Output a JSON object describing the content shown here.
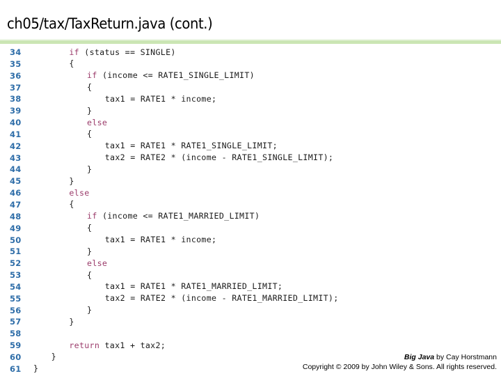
{
  "slide": {
    "title": "ch05/tax/TaxReturn.java (cont.)",
    "accent_color": "#CBE6B4",
    "line_number_color": "#2E6DA8",
    "keyword_color": "#9B3C6B",
    "code_color": "#1a1a1a",
    "background_color": "#ffffff"
  },
  "code": {
    "language": "java",
    "first_line_number": 34,
    "last_line_number": 61,
    "lines": [
      {
        "n": "34",
        "indent": 6,
        "keyword": "if",
        "rest": " (status == SINGLE)"
      },
      {
        "n": "35",
        "indent": 6,
        "keyword": "",
        "rest": "{"
      },
      {
        "n": "36",
        "indent": 9,
        "keyword": "if",
        "rest": " (income <= RATE1_SINGLE_LIMIT)"
      },
      {
        "n": "37",
        "indent": 9,
        "keyword": "",
        "rest": "{"
      },
      {
        "n": "38",
        "indent": 12,
        "keyword": "",
        "rest": "tax1 = RATE1 * income;"
      },
      {
        "n": "39",
        "indent": 9,
        "keyword": "",
        "rest": "}"
      },
      {
        "n": "40",
        "indent": 9,
        "keyword": "else",
        "rest": ""
      },
      {
        "n": "41",
        "indent": 9,
        "keyword": "",
        "rest": "{"
      },
      {
        "n": "42",
        "indent": 12,
        "keyword": "",
        "rest": "tax1 = RATE1 * RATE1_SINGLE_LIMIT;"
      },
      {
        "n": "43",
        "indent": 12,
        "keyword": "",
        "rest": "tax2 = RATE2 * (income - RATE1_SINGLE_LIMIT);"
      },
      {
        "n": "44",
        "indent": 9,
        "keyword": "",
        "rest": "}"
      },
      {
        "n": "45",
        "indent": 6,
        "keyword": "",
        "rest": "}"
      },
      {
        "n": "46",
        "indent": 6,
        "keyword": "else",
        "rest": ""
      },
      {
        "n": "47",
        "indent": 6,
        "keyword": "",
        "rest": "{"
      },
      {
        "n": "48",
        "indent": 9,
        "keyword": "if",
        "rest": " (income <= RATE1_MARRIED_LIMIT)"
      },
      {
        "n": "49",
        "indent": 9,
        "keyword": "",
        "rest": "{"
      },
      {
        "n": "50",
        "indent": 12,
        "keyword": "",
        "rest": "tax1 = RATE1 * income;"
      },
      {
        "n": "51",
        "indent": 9,
        "keyword": "",
        "rest": "}"
      },
      {
        "n": "52",
        "indent": 9,
        "keyword": "else",
        "rest": ""
      },
      {
        "n": "53",
        "indent": 9,
        "keyword": "",
        "rest": "{"
      },
      {
        "n": "54",
        "indent": 12,
        "keyword": "",
        "rest": "tax1 = RATE1 * RATE1_MARRIED_LIMIT;"
      },
      {
        "n": "55",
        "indent": 12,
        "keyword": "",
        "rest": "tax2 = RATE2 * (income - RATE1_MARRIED_LIMIT);"
      },
      {
        "n": "56",
        "indent": 9,
        "keyword": "",
        "rest": "}"
      },
      {
        "n": "57",
        "indent": 6,
        "keyword": "",
        "rest": "}"
      },
      {
        "n": "58",
        "indent": 0,
        "keyword": "",
        "rest": ""
      },
      {
        "n": "59",
        "indent": 6,
        "keyword": "return",
        "rest": " tax1 + tax2;"
      },
      {
        "n": "60",
        "indent": 3,
        "keyword": "",
        "rest": "}"
      },
      {
        "n": "61",
        "indent": 0,
        "keyword": "",
        "rest": "}"
      }
    ]
  },
  "attribution": {
    "book_title": "Big Java",
    "byline": " by Cay Horstmann",
    "copyright": "Copyright © 2009 by John Wiley & Sons.  All rights reserved."
  }
}
